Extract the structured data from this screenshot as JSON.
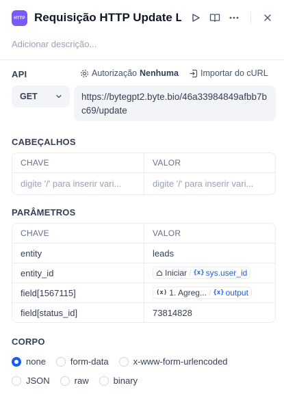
{
  "header": {
    "icon_text": "HTTP",
    "title": "Requisição HTTP Update Le"
  },
  "description_placeholder": "Adicionar descrição...",
  "api": {
    "section": "API",
    "auth_label": "Autorização",
    "auth_value": "Nenhuma",
    "import_label": "Importar do cURL",
    "method": "GET",
    "url": "https://bytegpt2.byte.bio/46a33984849afbb7bc69/update"
  },
  "headers": {
    "section": "CABEÇALHOS",
    "col_key": "CHAVE",
    "col_value": "VALOR",
    "key_placeholder": "digite '/' para inserir vari...",
    "value_placeholder": "digite '/' para inserir vari..."
  },
  "params": {
    "section": "PARÂMETROS",
    "col_key": "CHAVE",
    "col_value": "VALOR",
    "rows": [
      {
        "key": "entity",
        "value": "leads"
      },
      {
        "key": "entity_id",
        "node": "Iniciar",
        "var": "sys.user_id"
      },
      {
        "key": "field[1567115]",
        "node": "1. Agreg...",
        "var": "output"
      },
      {
        "key": "field[status_id]",
        "value": "73814828"
      }
    ]
  },
  "body": {
    "section": "CORPO",
    "options": [
      "none",
      "form-data",
      "x-www-form-urlencoded",
      "JSON",
      "raw",
      "binary"
    ],
    "selected": "none"
  },
  "colors": {
    "accent": "#155eef",
    "node_icon": "#7a5af8"
  }
}
